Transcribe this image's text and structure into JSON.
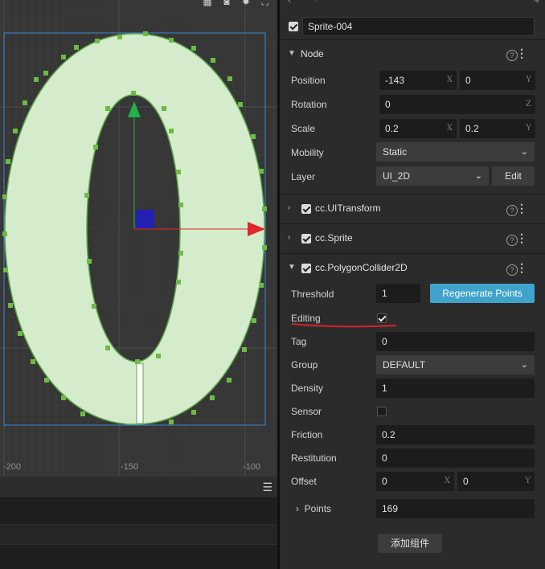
{
  "scene": {
    "toolbar_icons": [
      "grid-icon",
      "camera-icon",
      "gear-icon",
      "transform-icon"
    ],
    "axis_labels": [
      "-200",
      "-150",
      "-100"
    ]
  },
  "inspector": {
    "node_name": "Sprite-004",
    "node_section": "Node",
    "position": {
      "label": "Position",
      "x": "-143",
      "y": "0"
    },
    "rotation": {
      "label": "Rotation",
      "z": "0"
    },
    "scale": {
      "label": "Scale",
      "x": "0.2",
      "y": "0.2"
    },
    "mobility": {
      "label": "Mobility",
      "value": "Static"
    },
    "layer": {
      "label": "Layer",
      "value": "UI_2D",
      "edit_label": "Edit"
    },
    "components": [
      "cc.UITransform",
      "cc.Sprite",
      "cc.PolygonCollider2D"
    ],
    "collider": {
      "threshold_label": "Threshold",
      "threshold": "1",
      "regenerate_label": "Regenerate Points",
      "editing_label": "Editing",
      "tag_label": "Tag",
      "tag": "0",
      "group_label": "Group",
      "group": "DEFAULT",
      "density_label": "Density",
      "density": "1",
      "sensor_label": "Sensor",
      "friction_label": "Friction",
      "friction": "0.2",
      "restitution_label": "Restitution",
      "restitution": "0",
      "offset_label": "Offset",
      "offset_x": "0",
      "offset_y": "0",
      "points_label": "Points",
      "points": "169"
    },
    "add_component_label": "添加组件",
    "axis_letters": {
      "x": "X",
      "y": "Y",
      "z": "Z"
    }
  },
  "colors": {
    "accent": "#3fa3cb",
    "fill": "#d4eccb",
    "vertex": "#6dbb45",
    "annotation": "#d8232a"
  }
}
